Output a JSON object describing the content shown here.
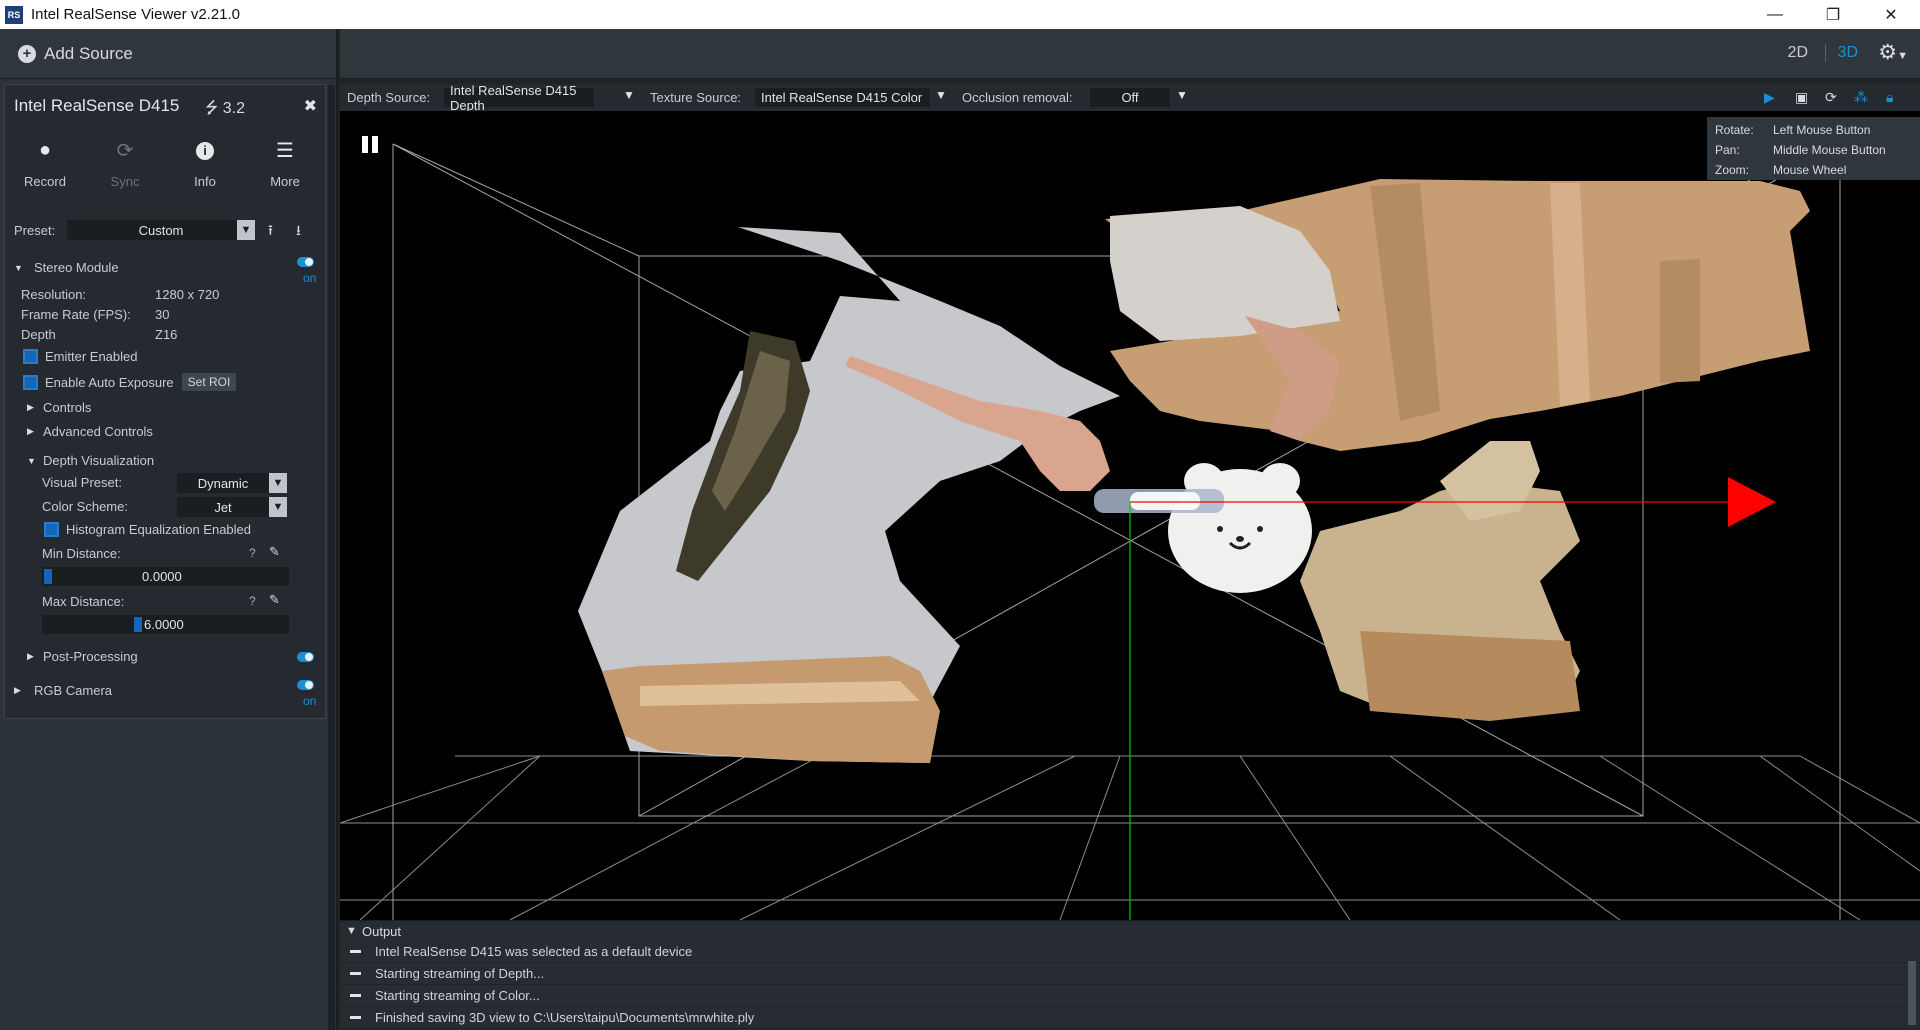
{
  "window": {
    "title": "Intel RealSense Viewer v2.21.0",
    "icon": "RS",
    "controls": {
      "minimize": "—",
      "maximize": "❐",
      "close": "✕"
    }
  },
  "sidebar": {
    "add_source": "Add Source",
    "device": {
      "name": "Intel RealSense D415",
      "usb": "3.2",
      "close": "✖",
      "toolbar": [
        {
          "label": "Record",
          "icon": "record-icon",
          "glyph": "●"
        },
        {
          "label": "Sync",
          "icon": "sync-icon",
          "glyph": "⟳"
        },
        {
          "label": "Info",
          "icon": "info-icon",
          "glyph": "ℹ"
        },
        {
          "label": "More",
          "icon": "menu-icon",
          "glyph": "☰"
        }
      ],
      "preset_label": "Preset:",
      "preset_value": "Custom",
      "stereo_module": {
        "title": "Stereo Module",
        "toggle_text": "on",
        "resolution_label": "Resolution:",
        "resolution_value": "1280 x 720",
        "fps_label": "Frame Rate (FPS):",
        "fps_value": "30",
        "format_label": "Depth",
        "format_value": "Z16",
        "emitter_label": "Emitter Enabled",
        "auto_exposure_label": "Enable Auto Exposure",
        "set_roi": "Set ROI",
        "controls": "Controls",
        "advanced_controls": "Advanced Controls",
        "depth_vis": {
          "title": "Depth Visualization",
          "visual_preset_label": "Visual Preset:",
          "visual_preset_value": "Dynamic",
          "color_scheme_label": "Color Scheme:",
          "color_scheme_value": "Jet",
          "histogram_label": "Histogram Equalization Enabled",
          "min_distance_label": "Min Distance:",
          "min_distance_value": "0.0000",
          "max_distance_label": "Max Distance:",
          "max_distance_value": "6.0000",
          "min_fraction": 0.0,
          "max_fraction": 0.375
        },
        "post_processing": "Post-Processing"
      },
      "rgb_camera": {
        "title": "RGB Camera",
        "toggle_text": "on"
      }
    }
  },
  "topbar": {
    "view_2d": "2D",
    "view_3d": "3D",
    "settings_glyph": "⚙"
  },
  "viewport_header": {
    "depth_source_label": "Depth Source:",
    "depth_source_value": "Intel RealSense D415 Depth",
    "texture_source_label": "Texture Source:",
    "texture_source_value": "Intel RealSense D415 Color",
    "occlusion_label": "Occlusion removal:",
    "occlusion_value": "Off"
  },
  "help": {
    "rotate_label": "Rotate:",
    "rotate_value": "Left Mouse Button",
    "pan_label": "Pan:",
    "pan_value": "Middle Mouse Button",
    "zoom_label": "Zoom:",
    "zoom_value": "Mouse Wheel"
  },
  "output": {
    "title": "Output",
    "lines": [
      "Intel RealSense D415 was selected as a default device",
      "Starting streaming of Depth...",
      "Starting streaming of Color...",
      "Finished saving 3D view to C:\\Users\\taipu\\Documents\\mrwhite.ply"
    ]
  },
  "colors": {
    "accent": "#1b8fd6",
    "checkbox": "#1565b8",
    "axis_x": "#ff0000",
    "axis_y": "#00cc00",
    "panel_bg": "#242a2f"
  }
}
